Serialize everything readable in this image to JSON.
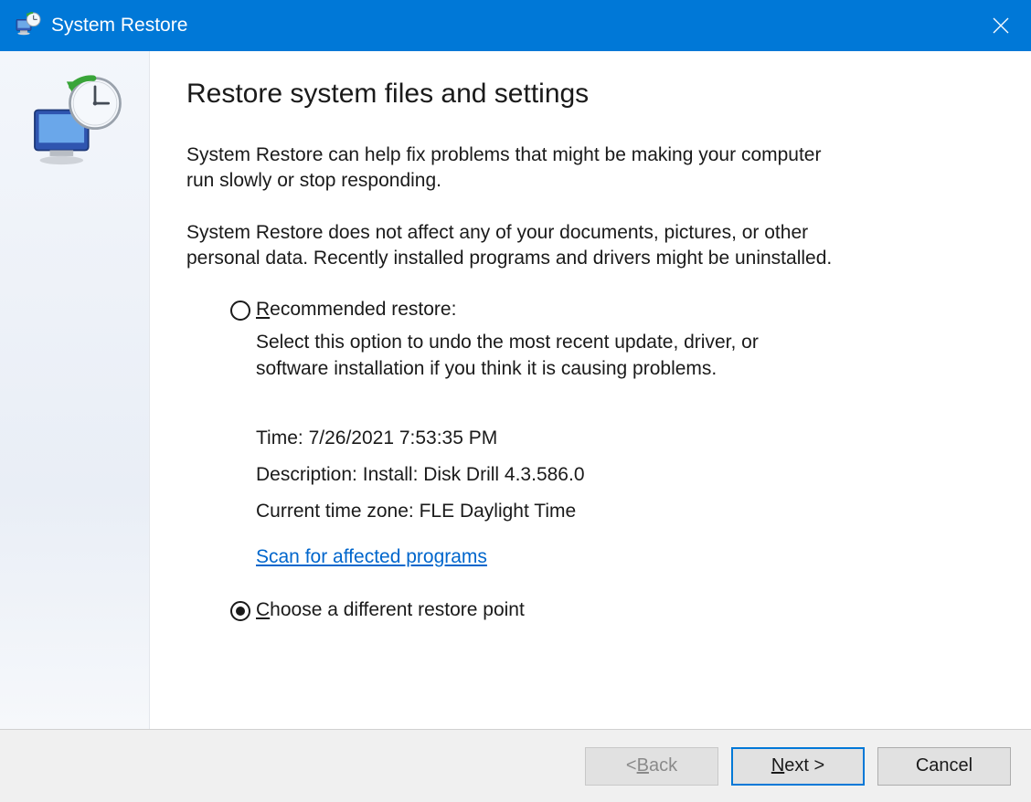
{
  "window": {
    "title": "System Restore"
  },
  "heading": "Restore system files and settings",
  "paragraphs": {
    "p1": "System Restore can help fix problems that might be making your computer run slowly or stop responding.",
    "p2": "System Restore does not affect any of your documents, pictures, or other personal data. Recently installed programs and drivers might be uninstalled."
  },
  "options": {
    "recommended": {
      "label": "Recommended restore:",
      "description": "Select this option to undo the most recent update, driver, or software installation if you think it is causing problems.",
      "time_label": "Time:",
      "time_value": "7/26/2021 7:53:35 PM",
      "desc_label": "Description:",
      "desc_value": "Install: Disk Drill 4.3.586.0",
      "tz_label": "Current time zone:",
      "tz_value": "FLE Daylight Time",
      "scan_link": "Scan for affected programs"
    },
    "different": {
      "label": "Choose a different restore point"
    },
    "selected": "different"
  },
  "footer": {
    "back": "< Back",
    "next": "Next >",
    "cancel": "Cancel"
  }
}
